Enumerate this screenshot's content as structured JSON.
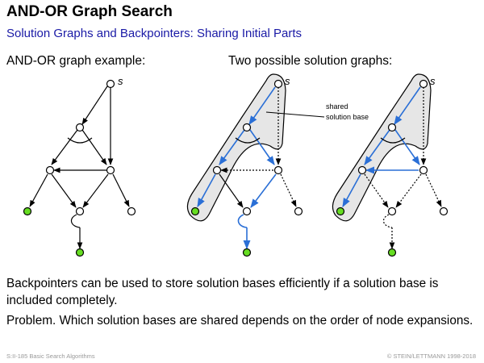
{
  "slide": {
    "title": "AND-OR Graph Search",
    "subtitle": "Solution Graphs and Backpointers: Sharing Initial Parts"
  },
  "left_panel": {
    "label": "AND-OR graph example:"
  },
  "right_panel": {
    "label": "Two possible solution graphs:"
  },
  "diagram": {
    "start_node_label": "s",
    "annotation_line1": "shared",
    "annotation_line2": "solution base",
    "colors": {
      "solution_edge": "#2a6fd6",
      "goal_node": "#66dd22",
      "shared_region": "#e6e6e6",
      "edge": "#000000"
    }
  },
  "body": {
    "paragraph1": "Backpointers can be used to store solution bases efficiently if a solution base is included completely.",
    "paragraph2": "Problem. Which solution bases are shared depends on the order of node expansions."
  },
  "footer": {
    "left": "S:II-185   Basic Search Algorithms",
    "right": "© STEIN/LETTMANN 1998-2018"
  }
}
